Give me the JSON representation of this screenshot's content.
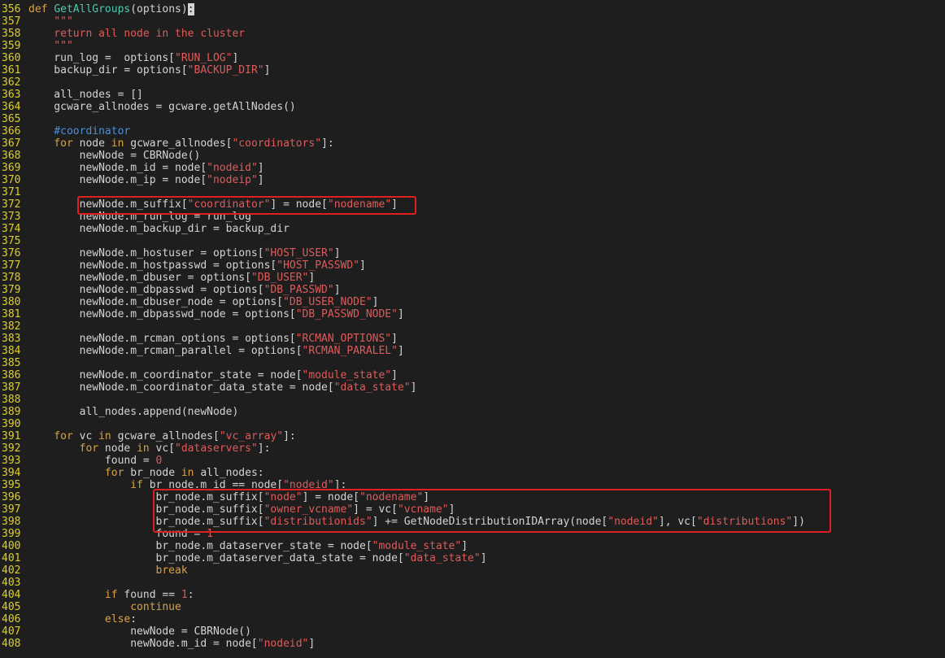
{
  "lines": [
    {
      "n": "356",
      "t": [
        [
          "kw",
          "def "
        ],
        [
          "fn",
          "GetAllGroups"
        ],
        [
          "plain",
          "(options)"
        ],
        [
          "cursor",
          ":"
        ]
      ]
    },
    {
      "n": "357",
      "t": [
        [
          "str",
          "    \"\"\""
        ]
      ]
    },
    {
      "n": "358",
      "t": [
        [
          "str",
          "    return all node in the cluster"
        ]
      ]
    },
    {
      "n": "359",
      "t": [
        [
          "str",
          "    \"\"\""
        ]
      ]
    },
    {
      "n": "360",
      "t": [
        [
          "plain",
          "    run_log =  options["
        ],
        [
          "str",
          "\"RUN_LOG\""
        ],
        [
          "plain",
          "]"
        ]
      ]
    },
    {
      "n": "361",
      "t": [
        [
          "plain",
          "    backup_dir = options["
        ],
        [
          "str",
          "\"BACKUP_DIR\""
        ],
        [
          "plain",
          "]"
        ]
      ]
    },
    {
      "n": "362",
      "t": []
    },
    {
      "n": "363",
      "t": [
        [
          "plain",
          "    all_nodes = []"
        ]
      ]
    },
    {
      "n": "364",
      "t": [
        [
          "plain",
          "    gcware_allnodes = gcware.getAllNodes()"
        ]
      ]
    },
    {
      "n": "365",
      "t": []
    },
    {
      "n": "366",
      "t": [
        [
          "cm",
          "    #coordinator"
        ]
      ]
    },
    {
      "n": "367",
      "t": [
        [
          "kw",
          "    for "
        ],
        [
          "plain",
          "node "
        ],
        [
          "kw",
          "in "
        ],
        [
          "plain",
          "gcware_allnodes["
        ],
        [
          "str",
          "\"coordinators\""
        ],
        [
          "plain",
          "]:"
        ]
      ]
    },
    {
      "n": "368",
      "t": [
        [
          "plain",
          "        newNode = CBRNode()"
        ]
      ]
    },
    {
      "n": "369",
      "t": [
        [
          "plain",
          "        newNode.m_id = node["
        ],
        [
          "str",
          "\"nodeid\""
        ],
        [
          "plain",
          "]"
        ]
      ]
    },
    {
      "n": "370",
      "t": [
        [
          "plain",
          "        newNode.m_ip = node["
        ],
        [
          "str",
          "\"nodeip\""
        ],
        [
          "plain",
          "]"
        ]
      ]
    },
    {
      "n": "371",
      "t": []
    },
    {
      "n": "372",
      "t": [
        [
          "plain",
          "        newNode.m_suffix["
        ],
        [
          "str",
          "\"coordinator\""
        ],
        [
          "plain",
          "] = node["
        ],
        [
          "str",
          "\"nodename\""
        ],
        [
          "plain",
          "]"
        ]
      ]
    },
    {
      "n": "373",
      "t": [
        [
          "plain",
          "        newNode.m_run_log = run_log"
        ]
      ]
    },
    {
      "n": "374",
      "t": [
        [
          "plain",
          "        newNode.m_backup_dir = backup_dir"
        ]
      ]
    },
    {
      "n": "375",
      "t": []
    },
    {
      "n": "376",
      "t": [
        [
          "plain",
          "        newNode.m_hostuser = options["
        ],
        [
          "str",
          "\"HOST_USER\""
        ],
        [
          "plain",
          "]"
        ]
      ]
    },
    {
      "n": "377",
      "t": [
        [
          "plain",
          "        newNode.m_hostpasswd = options["
        ],
        [
          "str",
          "\"HOST_PASSWD\""
        ],
        [
          "plain",
          "]"
        ]
      ]
    },
    {
      "n": "378",
      "t": [
        [
          "plain",
          "        newNode.m_dbuser = options["
        ],
        [
          "str",
          "\"DB_USER\""
        ],
        [
          "plain",
          "]"
        ]
      ]
    },
    {
      "n": "379",
      "t": [
        [
          "plain",
          "        newNode.m_dbpasswd = options["
        ],
        [
          "str",
          "\"DB_PASSWD\""
        ],
        [
          "plain",
          "]"
        ]
      ]
    },
    {
      "n": "380",
      "t": [
        [
          "plain",
          "        newNode.m_dbuser_node = options["
        ],
        [
          "str",
          "\"DB_USER_NODE\""
        ],
        [
          "plain",
          "]"
        ]
      ]
    },
    {
      "n": "381",
      "t": [
        [
          "plain",
          "        newNode.m_dbpasswd_node = options["
        ],
        [
          "str",
          "\"DB_PASSWD_NODE\""
        ],
        [
          "plain",
          "]"
        ]
      ]
    },
    {
      "n": "382",
      "t": []
    },
    {
      "n": "383",
      "t": [
        [
          "plain",
          "        newNode.m_rcman_options = options["
        ],
        [
          "str",
          "\"RCMAN_OPTIONS\""
        ],
        [
          "plain",
          "]"
        ]
      ]
    },
    {
      "n": "384",
      "t": [
        [
          "plain",
          "        newNode.m_rcman_parallel = options["
        ],
        [
          "str",
          "\"RCMAN_PARALEL\""
        ],
        [
          "plain",
          "]"
        ]
      ]
    },
    {
      "n": "385",
      "t": []
    },
    {
      "n": "386",
      "t": [
        [
          "plain",
          "        newNode.m_coordinator_state = node["
        ],
        [
          "str",
          "\"module_state\""
        ],
        [
          "plain",
          "]"
        ]
      ]
    },
    {
      "n": "387",
      "t": [
        [
          "plain",
          "        newNode.m_coordinator_data_state = node["
        ],
        [
          "str",
          "\"data_state\""
        ],
        [
          "plain",
          "]"
        ]
      ]
    },
    {
      "n": "388",
      "t": []
    },
    {
      "n": "389",
      "t": [
        [
          "plain",
          "        all_nodes.append(newNode)"
        ]
      ]
    },
    {
      "n": "390",
      "t": []
    },
    {
      "n": "391",
      "t": [
        [
          "kw",
          "    for "
        ],
        [
          "plain",
          "vc "
        ],
        [
          "kw",
          "in "
        ],
        [
          "plain",
          "gcware_allnodes["
        ],
        [
          "str",
          "\"vc_array\""
        ],
        [
          "plain",
          "]:"
        ]
      ]
    },
    {
      "n": "392",
      "t": [
        [
          "kw",
          "        for "
        ],
        [
          "plain",
          "node "
        ],
        [
          "kw",
          "in "
        ],
        [
          "plain",
          "vc["
        ],
        [
          "str",
          "\"dataservers\""
        ],
        [
          "plain",
          "]:"
        ]
      ]
    },
    {
      "n": "393",
      "t": [
        [
          "plain",
          "            found = "
        ],
        [
          "num",
          "0"
        ]
      ]
    },
    {
      "n": "394",
      "t": [
        [
          "kw",
          "            for "
        ],
        [
          "plain",
          "br_node "
        ],
        [
          "kw",
          "in "
        ],
        [
          "plain",
          "all_nodes:"
        ]
      ]
    },
    {
      "n": "395",
      "t": [
        [
          "kw",
          "                if "
        ],
        [
          "plain",
          "br_node.m_id == node["
        ],
        [
          "str",
          "\"nodeid\""
        ],
        [
          "plain",
          "]:"
        ]
      ]
    },
    {
      "n": "396",
      "t": [
        [
          "plain",
          "                    br_node.m_suffix["
        ],
        [
          "str",
          "\"node\""
        ],
        [
          "plain",
          "] = node["
        ],
        [
          "str",
          "\"nodename\""
        ],
        [
          "plain",
          "]"
        ]
      ]
    },
    {
      "n": "397",
      "t": [
        [
          "plain",
          "                    br_node.m_suffix["
        ],
        [
          "str",
          "\"owner_vcname\""
        ],
        [
          "plain",
          "] = vc["
        ],
        [
          "str",
          "\"vcname\""
        ],
        [
          "plain",
          "]"
        ]
      ]
    },
    {
      "n": "398",
      "t": [
        [
          "plain",
          "                    br_node.m_suffix["
        ],
        [
          "str",
          "\"distributionids\""
        ],
        [
          "plain",
          "] += GetNodeDistributionIDArray(node["
        ],
        [
          "str",
          "\"nodeid\""
        ],
        [
          "plain",
          "], vc["
        ],
        [
          "str",
          "\"distributions\""
        ],
        [
          "plain",
          "])"
        ]
      ]
    },
    {
      "n": "399",
      "t": [
        [
          "plain",
          "                    found = "
        ],
        [
          "num",
          "1"
        ]
      ]
    },
    {
      "n": "400",
      "t": [
        [
          "plain",
          "                    br_node.m_dataserver_state = node["
        ],
        [
          "str",
          "\"module_state\""
        ],
        [
          "plain",
          "]"
        ]
      ]
    },
    {
      "n": "401",
      "t": [
        [
          "plain",
          "                    br_node.m_dataserver_data_state = node["
        ],
        [
          "str",
          "\"data_state\""
        ],
        [
          "plain",
          "]"
        ]
      ]
    },
    {
      "n": "402",
      "t": [
        [
          "kw",
          "                    break"
        ]
      ]
    },
    {
      "n": "403",
      "t": []
    },
    {
      "n": "404",
      "t": [
        [
          "kw",
          "            if "
        ],
        [
          "plain",
          "found == "
        ],
        [
          "num",
          "1"
        ],
        [
          "plain",
          ":"
        ]
      ]
    },
    {
      "n": "405",
      "t": [
        [
          "kw",
          "                continue"
        ]
      ]
    },
    {
      "n": "406",
      "t": [
        [
          "kw",
          "            else"
        ],
        [
          "plain",
          ":"
        ]
      ]
    },
    {
      "n": "407",
      "t": [
        [
          "plain",
          "                newNode = CBRNode()"
        ]
      ]
    },
    {
      "n": "408",
      "t": [
        [
          "plain",
          "                newNode.m_id = node["
        ],
        [
          "str",
          "\"nodeid\""
        ],
        [
          "plain",
          "]"
        ]
      ]
    }
  ],
  "colors": {
    "background": "#1e1e1e",
    "line_number": "#e0d020",
    "keyword": "#d7a24a",
    "function": "#4ec9b0",
    "string": "#e05a5a",
    "comment": "#4a90d9",
    "highlight_box": "#e02020"
  }
}
